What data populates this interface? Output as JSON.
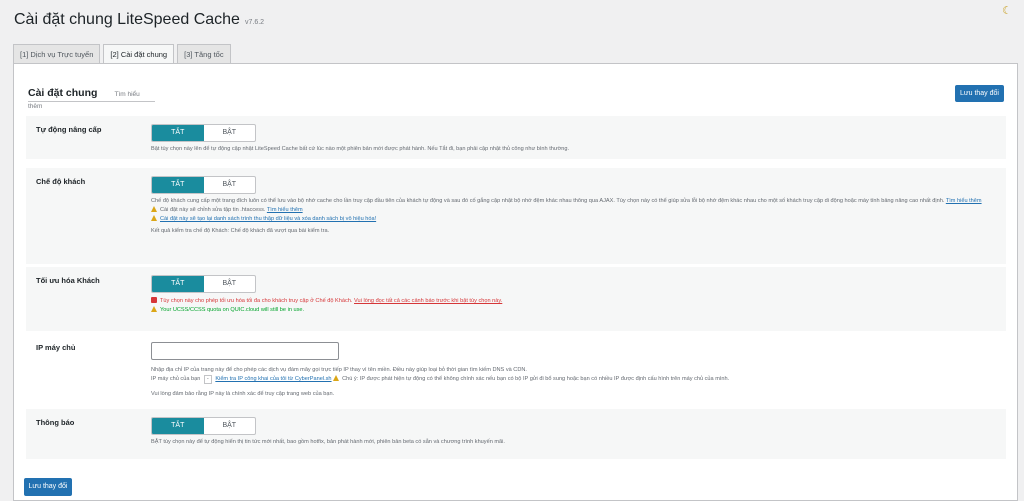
{
  "header": {
    "title": "Cài đặt chung LiteSpeed Cache",
    "version": "v7.6.2",
    "theme_icon": "moon-icon"
  },
  "tabs": [
    {
      "label": "[1] Dịch vụ Trực tuyến",
      "active": false
    },
    {
      "label": "[2] Cài đặt chung",
      "active": true
    },
    {
      "label": "[3] Tăng tốc",
      "active": false
    }
  ],
  "section": {
    "title": "Cài đặt chung",
    "learn_more": "Tìm hiểu thêm"
  },
  "save_label": "Lưu thay đổi",
  "toggle": {
    "off": "TẮT",
    "on": "BẬT"
  },
  "accent_color": "#1a8c9e",
  "rows": {
    "auto_upgrade": {
      "label": "Tự động nâng cấp",
      "desc": "Bật tùy chọn này lên để tự động cập nhật LiteSpeed Cache bất cứ lúc nào một phiên bản mới được phát hành. Nếu Tắt đi, bạn phải cập nhật thủ công như bình thường."
    },
    "guest_mode": {
      "label": "Chế độ khách",
      "desc": "Chế độ khách cung cấp một trang đích luôn có thể lưu vào bộ nhớ cache cho lần truy cập đầu tiên của khách tự động và sau đó cố gắng cập nhật bộ nhớ đệm khác nhau thông qua AJAX. Tùy chọn này có thể giúp sửa lỗi bộ nhớ đệm khác nhau cho một số khách truy cập di động hoặc máy tính bảng nâng cao nhất định.",
      "desc_link": "Tìm hiểu thêm",
      "warn1": "Cài đặt này sẽ chỉnh sửa tập tin .htaccess.",
      "warn1_link": "Tìm hiểu thêm",
      "warn2": "Cài đặt này sẽ tạo lại danh sách trình thu thập dữ liệu và xóa danh sách bị vô hiệu hóa!",
      "result": "Kết quả kiểm tra chế độ Khách: Chế độ khách đã vượt qua bài kiểm tra."
    },
    "guest_optm": {
      "label": "Tối ưu hóa Khách",
      "warning": "Tùy chọn này cho phép tối ưu hóa tối đa cho khách truy cập ở Chế độ Khách.",
      "warning_link": "Vui lòng đọc tất cả các cảnh báo trước khi bật tùy chọn này.",
      "quota": "Your UCSS/CCSS quota on QUIC.cloud will still be in use."
    },
    "server_ip": {
      "label": "IP máy chủ",
      "value": "",
      "desc": "Nhập địa chỉ IP của trang này để cho phép các dịch vụ đám mây gọi trực tiếp IP thay vì tên miền. Điều này giúp loại bỏ thời gian tìm kiếm DNS và CDN.",
      "your_ip_label": "IP máy chủ của bạn",
      "your_ip_value": "-",
      "check_link": "Kiểm tra IP công khai của tôi từ CyberPanel.sh",
      "note": "Chú ý: IP được phát hiện tự động có thể không chính xác nếu bạn có bộ IP gửi đi bổ sung hoặc bạn có nhiều IP được định cấu hình trên máy chủ của mình.",
      "confirm": "Vui lòng đảm bảo rằng IP này là chính xác để truy cập trang web của bạn."
    },
    "news": {
      "label": "Thông báo",
      "desc": "BẬT tùy chọn này để tự động hiển thị tin tức mới nhất, bao gồm hotfix, bản phát hành mới, phiên bản beta có sẵn và chương trình khuyến mãi."
    }
  }
}
